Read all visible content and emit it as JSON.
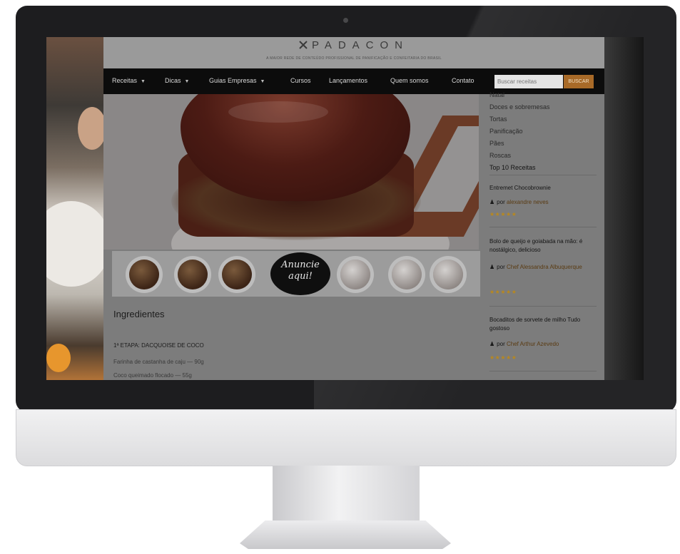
{
  "site": {
    "logo": "PADACON",
    "tagline": "A MAIOR REDE DE CONTEÚDO PROFISSIONAL DE PANIFICAÇÃO E CONFEITARIA DO BRASIL"
  },
  "nav": {
    "items": [
      {
        "label": "Receitas",
        "dropdown": true
      },
      {
        "label": "Dicas",
        "dropdown": true
      },
      {
        "label": "Guias Empresas",
        "dropdown": true
      },
      {
        "label": "Cursos",
        "dropdown": false
      },
      {
        "label": "Lançamentos",
        "dropdown": false
      },
      {
        "label": "Quem somos",
        "dropdown": false
      },
      {
        "label": "Contato",
        "dropdown": false
      }
    ],
    "search_placeholder": "Buscar receitas",
    "search_button": "BUSCAR"
  },
  "banner": {
    "text_line1": "Anuncie",
    "text_line2": "aqui!"
  },
  "article": {
    "section_title": "Ingredientes",
    "step_title": "1ª ETAPA: DACQUOISE DE COCO",
    "ingredients": [
      "Farinha de castanha de caju — 90g",
      "Coco queimado flocado — 55g"
    ]
  },
  "sidebar": {
    "categories": [
      "Natal",
      "Doces e sobremesas",
      "Tortas",
      "Panificação",
      "Pães",
      "Roscas",
      "Top 10 Receitas"
    ],
    "posts": [
      {
        "title": "Entremet Chocobrownie",
        "by": "por",
        "author": "alexandre neves",
        "rating_stars": "★★★★★"
      },
      {
        "title": "Bolo de queijo e goiabada na mão: é nostálgico, delicioso",
        "by": "por",
        "author": "Chef Alessandra Albuquerque",
        "rating_stars": "★★★★★"
      },
      {
        "title": "Bocaditos de sorvete de milho Tudo gostoso",
        "by": "por",
        "author": "Chef Arthur Azevedo",
        "rating_stars": "★★★★★"
      }
    ]
  },
  "colors": {
    "nav_bg": "#0c0c0c",
    "search_button": "#a86a28",
    "stars": "#b8881e"
  }
}
